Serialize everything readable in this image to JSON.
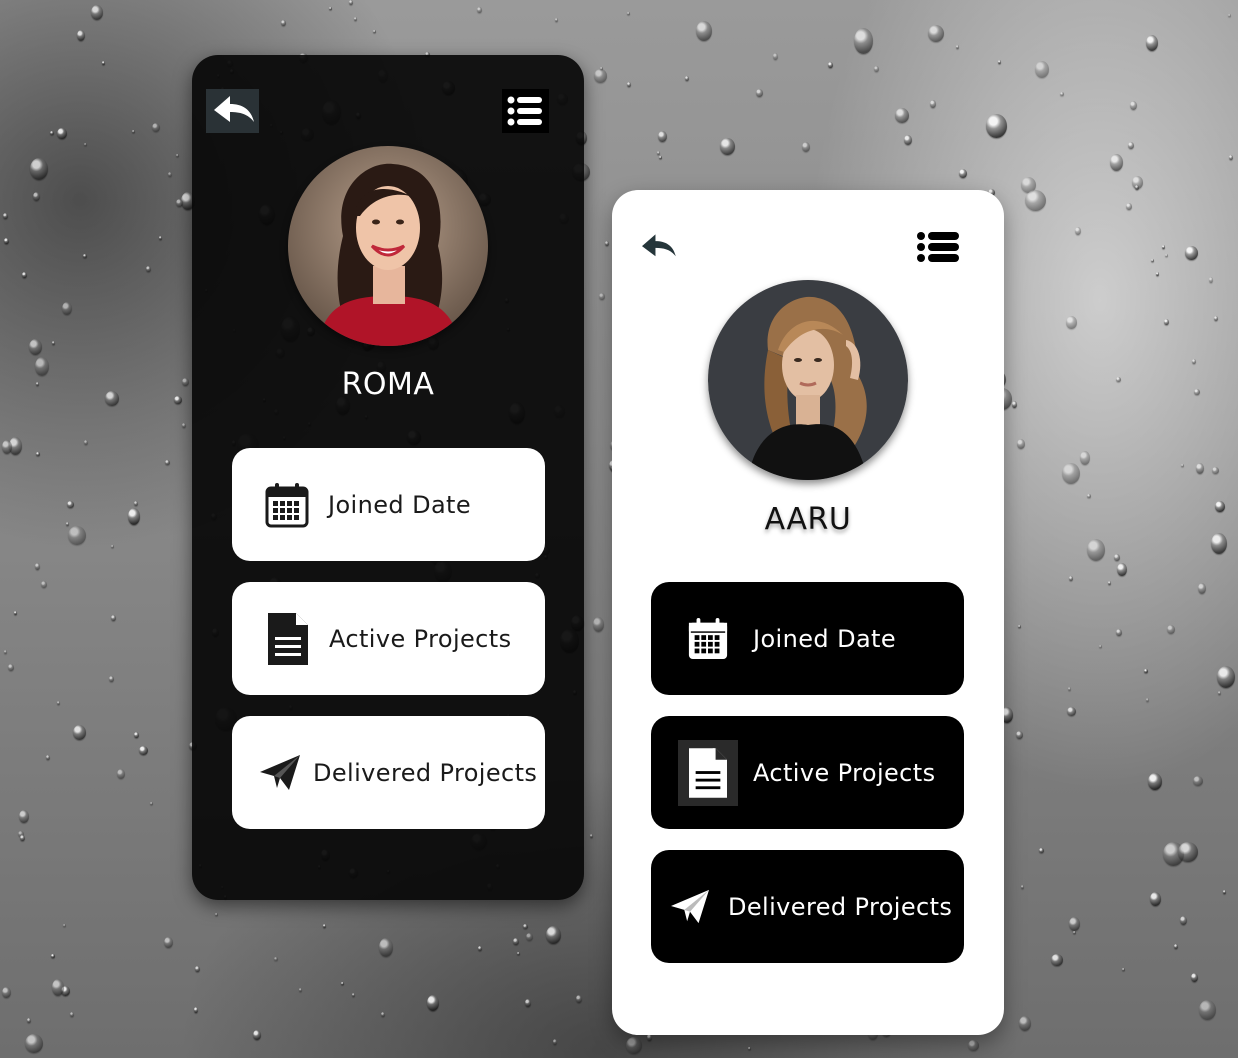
{
  "background": {
    "theme": "rain-on-glass",
    "tone": "grayscale"
  },
  "cards": [
    {
      "theme": "dark",
      "back_icon": "back-arrow-icon",
      "menu_icon": "list-menu-icon",
      "profile": {
        "name": "ROMA",
        "avatar_desc": "smiling woman, dark hair, red top"
      },
      "items": [
        {
          "label": "Joined Date",
          "icon": "calendar-icon"
        },
        {
          "label": "Active Projects",
          "icon": "document-icon"
        },
        {
          "label": "Delivered Projects",
          "icon": "paper-plane-icon"
        }
      ]
    },
    {
      "theme": "light",
      "back_icon": "back-arrow-icon",
      "menu_icon": "list-menu-icon",
      "profile": {
        "name": "AARU",
        "avatar_desc": "woman with long wavy blonde hair, black top"
      },
      "items": [
        {
          "label": "Joined Date",
          "icon": "calendar-icon"
        },
        {
          "label": "Active Projects",
          "icon": "document-icon"
        },
        {
          "label": "Delivered Projects",
          "icon": "paper-plane-icon"
        }
      ]
    }
  ],
  "colors": {
    "dark_card": "#080808",
    "light_card": "#ffffff",
    "tile_light": "#ffffff",
    "tile_dark": "#000000",
    "text_on_dark": "#ffffff",
    "text_on_light": "#1a1a1a"
  }
}
